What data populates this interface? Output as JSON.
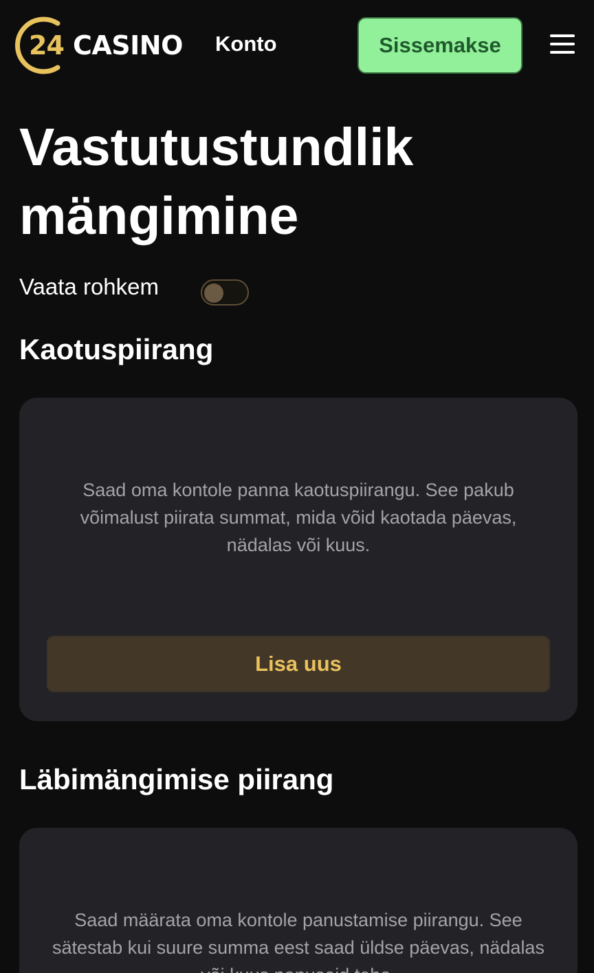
{
  "header": {
    "logo_number": "24",
    "logo_word": "CASINO",
    "nav_account": "Konto",
    "deposit_label": "Sissemakse"
  },
  "page": {
    "title_line1": "Vastutustundlik",
    "title_line2": "mängimine",
    "toggle_label": "Vaata rohkem",
    "toggle_on": false
  },
  "sections": [
    {
      "title": "Kaotuspiirang",
      "description": "Saad oma kontole panna kaotuspiirangu. See pakub võimalust piirata summat, mida võid kaotada päevas, nädalas või kuus.",
      "button_label": "Lisa uus"
    },
    {
      "title": "Läbimängimise piirang",
      "description": "Saad määrata oma kontole panustamise piirangu. See sätestab kui suure summa eest saad üldse päevas, nädalas või kuus panuseid teha."
    }
  ],
  "colors": {
    "background": "#0d0d0e",
    "card": "#232327",
    "brand_gold": "#e7c25d",
    "deposit_green": "#93f09a"
  }
}
